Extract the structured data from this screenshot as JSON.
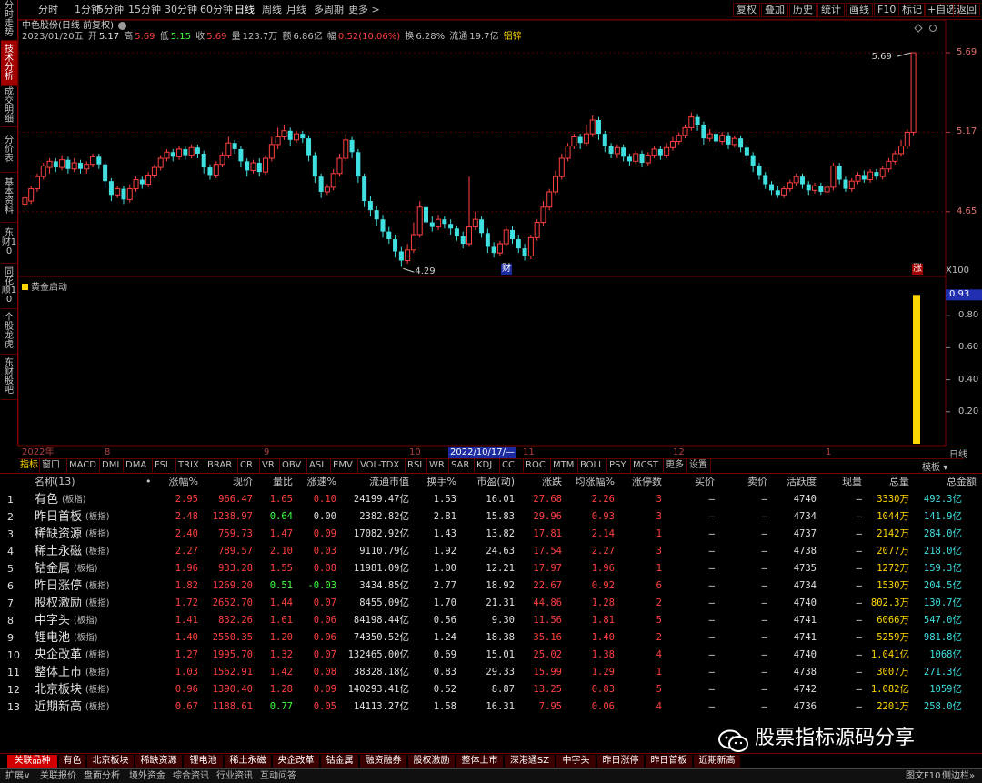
{
  "left_tabs": [
    {
      "label": "分时走势",
      "active": false
    },
    {
      "label": "技术分析",
      "active": true
    },
    {
      "label": "成交明细",
      "active": false
    },
    {
      "label": "分价表",
      "active": false
    },
    {
      "label": "基本资料",
      "active": false
    },
    {
      "label": "东财10",
      "active": false
    },
    {
      "label": "同花顺10",
      "active": false
    },
    {
      "label": "个股龙虎",
      "active": false
    },
    {
      "label": "东财股吧",
      "active": false
    }
  ],
  "periods": [
    "分时",
    "1分钟",
    "5分钟",
    "15分钟",
    "30分钟",
    "60分钟",
    "日线",
    "周线",
    "月线",
    "多周期",
    "更多 >"
  ],
  "active_period": "日线",
  "right_buttons": [
    "复权",
    "叠加",
    "历史",
    "统计",
    "画线",
    "F10",
    "标记",
    "+自选",
    "返回"
  ],
  "kinfo": {
    "title": "中色股份(日线 前复权)",
    "date": "2023/01/20五",
    "open_lbl": "开",
    "open": "5.17",
    "high_lbl": "高",
    "high": "5.69",
    "low_lbl": "低",
    "low": "5.15",
    "close_lbl": "收",
    "close": "5.69",
    "vol_lbl": "量",
    "vol": "123.7万",
    "amt_lbl": "额",
    "amt": "6.86亿",
    "chg_lbl": "幅",
    "chg": "0.52(10.06%)",
    "turn_lbl": "换",
    "turn": "6.28%",
    "float_lbl": "流通",
    "float": "19.7亿",
    "tag": "铝锌"
  },
  "price_axis": [
    "5.69",
    "5.17",
    "4.65"
  ],
  "price_max_label": "5.69",
  "price_min_label": "4.29",
  "fin_marker": "财",
  "zhang_marker": "涨",
  "scale_label": "X100",
  "indicator": {
    "name": "黄金启动",
    "current": "0.93",
    "axis": [
      "0.80",
      "0.60",
      "0.40",
      "0.20"
    ],
    "value": 0.93
  },
  "date_labels": [
    "2022年",
    "8",
    "9",
    "10",
    "2022/10/17/—",
    "11",
    "12",
    "1"
  ],
  "day_label": "日线",
  "ind_tabs": [
    "指标",
    "窗口",
    "MACD",
    "DMI",
    "DMA",
    "FSL",
    "TRIX",
    "BRAR",
    "CR",
    "VR",
    "OBV",
    "ASI",
    "EMV",
    "VOL-TDX",
    "RSI",
    "WR",
    "SAR",
    "KDJ",
    "CCI",
    "ROC",
    "MTM",
    "BOLL",
    "PSY",
    "MCST",
    "更多",
    "设置"
  ],
  "template_btn": "模板",
  "table": {
    "headers": [
      "名称(13)",
      "•",
      "涨幅%",
      "现价",
      "量比",
      "涨速%",
      "流通市值",
      "换手%",
      "市盈(动)",
      "涨跌",
      "均涨幅%",
      "涨停数",
      "买价",
      "卖价",
      "活跃度",
      "现量",
      "总量",
      "总金额"
    ],
    "rows": [
      {
        "no": "1",
        "name": "有色",
        "tag": "(板指)",
        "chg": "2.95",
        "price": "966.47",
        "vr": "1.65",
        "spd": "0.10",
        "mcap": "24199.47亿",
        "turn": "1.53",
        "pe": "16.01",
        "updn": "27.68",
        "avg": "2.26",
        "lim": "3",
        "buy": "—",
        "sell": "—",
        "act": "4740",
        "cur": "—",
        "vol": "3330万",
        "amt": "492.3亿"
      },
      {
        "no": "2",
        "name": "昨日首板",
        "tag": "(板指)",
        "chg": "2.48",
        "price": "1238.97",
        "vr": "0.64",
        "spd": "0.00",
        "mcap": "2382.82亿",
        "turn": "2.81",
        "pe": "15.83",
        "updn": "29.96",
        "avg": "0.93",
        "lim": "3",
        "buy": "—",
        "sell": "—",
        "act": "4734",
        "cur": "—",
        "vol": "1044万",
        "amt": "141.9亿"
      },
      {
        "no": "3",
        "name": "稀缺资源",
        "tag": "(板指)",
        "chg": "2.40",
        "price": "759.73",
        "vr": "1.47",
        "spd": "0.09",
        "mcap": "17082.92亿",
        "turn": "1.43",
        "pe": "13.82",
        "updn": "17.81",
        "avg": "2.14",
        "lim": "1",
        "buy": "—",
        "sell": "—",
        "act": "4737",
        "cur": "—",
        "vol": "2142万",
        "amt": "284.0亿"
      },
      {
        "no": "4",
        "name": "稀土永磁",
        "tag": "(板指)",
        "chg": "2.27",
        "price": "789.57",
        "vr": "2.10",
        "spd": "0.03",
        "mcap": "9110.79亿",
        "turn": "1.92",
        "pe": "24.63",
        "updn": "17.54",
        "avg": "2.27",
        "lim": "3",
        "buy": "—",
        "sell": "—",
        "act": "4738",
        "cur": "—",
        "vol": "2077万",
        "amt": "218.0亿"
      },
      {
        "no": "5",
        "name": "钴金属",
        "tag": "(板指)",
        "chg": "1.96",
        "price": "933.28",
        "vr": "1.55",
        "spd": "0.08",
        "mcap": "11981.09亿",
        "turn": "1.00",
        "pe": "12.21",
        "updn": "17.97",
        "avg": "1.96",
        "lim": "1",
        "buy": "—",
        "sell": "—",
        "act": "4735",
        "cur": "—",
        "vol": "1272万",
        "amt": "159.3亿"
      },
      {
        "no": "6",
        "name": "昨日涨停",
        "tag": "(板指)",
        "chg": "1.82",
        "price": "1269.20",
        "vr": "0.51",
        "spd": "-0.03",
        "mcap": "3434.85亿",
        "turn": "2.77",
        "pe": "18.92",
        "updn": "22.67",
        "avg": "0.92",
        "lim": "6",
        "buy": "—",
        "sell": "—",
        "act": "4734",
        "cur": "—",
        "vol": "1530万",
        "amt": "204.5亿"
      },
      {
        "no": "7",
        "name": "股权激励",
        "tag": "(板指)",
        "chg": "1.72",
        "price": "2652.70",
        "vr": "1.44",
        "spd": "0.07",
        "mcap": "8455.09亿",
        "turn": "1.70",
        "pe": "21.31",
        "updn": "44.86",
        "avg": "1.28",
        "lim": "2",
        "buy": "—",
        "sell": "—",
        "act": "4740",
        "cur": "—",
        "vol": "802.3万",
        "amt": "130.7亿"
      },
      {
        "no": "8",
        "name": "中字头",
        "tag": "(板指)",
        "chg": "1.41",
        "price": "832.26",
        "vr": "1.61",
        "spd": "0.06",
        "mcap": "84198.44亿",
        "turn": "0.56",
        "pe": "9.30",
        "updn": "11.56",
        "avg": "1.81",
        "lim": "5",
        "buy": "—",
        "sell": "—",
        "act": "4741",
        "cur": "—",
        "vol": "6066万",
        "amt": "547.0亿"
      },
      {
        "no": "9",
        "name": "锂电池",
        "tag": "(板指)",
        "chg": "1.40",
        "price": "2550.35",
        "vr": "1.20",
        "spd": "0.06",
        "mcap": "74350.52亿",
        "turn": "1.24",
        "pe": "18.38",
        "updn": "35.16",
        "avg": "1.40",
        "lim": "2",
        "buy": "—",
        "sell": "—",
        "act": "4741",
        "cur": "—",
        "vol": "5259万",
        "amt": "981.8亿"
      },
      {
        "no": "10",
        "name": "央企改革",
        "tag": "(板指)",
        "chg": "1.27",
        "price": "1995.70",
        "vr": "1.32",
        "spd": "0.07",
        "mcap": "132465.00亿",
        "turn": "0.69",
        "pe": "15.01",
        "updn": "25.02",
        "avg": "1.38",
        "lim": "4",
        "buy": "—",
        "sell": "—",
        "act": "4740",
        "cur": "—",
        "vol": "1.041亿",
        "amt": "1068亿"
      },
      {
        "no": "11",
        "name": "整体上市",
        "tag": "(板指)",
        "chg": "1.03",
        "price": "1562.91",
        "vr": "1.42",
        "spd": "0.08",
        "mcap": "38328.18亿",
        "turn": "0.83",
        "pe": "29.33",
        "updn": "15.99",
        "avg": "1.29",
        "lim": "1",
        "buy": "—",
        "sell": "—",
        "act": "4738",
        "cur": "—",
        "vol": "3007万",
        "amt": "271.3亿"
      },
      {
        "no": "12",
        "name": "北京板块",
        "tag": "(板指)",
        "chg": "0.96",
        "price": "1390.40",
        "vr": "1.28",
        "spd": "0.09",
        "mcap": "140293.41亿",
        "turn": "0.52",
        "pe": "8.87",
        "updn": "13.25",
        "avg": "0.83",
        "lim": "5",
        "buy": "—",
        "sell": "—",
        "act": "4742",
        "cur": "—",
        "vol": "1.082亿",
        "amt": "1059亿"
      },
      {
        "no": "13",
        "name": "近期新高",
        "tag": "(板指)",
        "chg": "0.67",
        "price": "1188.61",
        "vr": "0.77",
        "spd": "0.05",
        "mcap": "14113.27亿",
        "turn": "1.58",
        "pe": "16.31",
        "updn": "7.95",
        "avg": "0.06",
        "lim": "4",
        "buy": "—",
        "sell": "—",
        "act": "4736",
        "cur": "—",
        "vol": "2201万",
        "amt": "258.0亿"
      }
    ]
  },
  "block_tabs": [
    "关联品种",
    "有色",
    "北京板块",
    "稀缺资源",
    "锂电池",
    "稀土永磁",
    "央企改革",
    "钴金属",
    "融资融券",
    "股权激励",
    "整体上市",
    "深港通SZ",
    "中字头",
    "昨日涨停",
    "昨日首板",
    "近期新高"
  ],
  "bottom_tabs": [
    "扩展∨",
    "关联报价",
    "盘面分析",
    "境外资金",
    "综合资讯",
    "行业资讯",
    "互动问答"
  ],
  "bottom_right": "图文F10",
  "bottom_right2": "侧边栏»",
  "watermark": "股票指标源码分享",
  "colors": {
    "up": "#ff4040",
    "down": "#40e0e0",
    "yellow": "#ffd700",
    "green": "#40ff40",
    "bg": "#000000",
    "frame": "#7a0000"
  },
  "chart_data": {
    "type": "candlestick",
    "title": "中色股份(日线 前复权)",
    "y_labels": [
      "5.69",
      "5.17",
      "4.65"
    ],
    "ylim": [
      4.25,
      5.75
    ],
    "candles": [
      [
        4.7,
        4.74,
        4.68,
        4.76
      ],
      [
        4.72,
        4.8,
        4.7,
        4.82
      ],
      [
        4.8,
        4.88,
        4.78,
        4.9
      ],
      [
        4.88,
        4.95,
        4.86,
        4.97
      ],
      [
        4.94,
        4.98,
        4.9,
        5.0
      ],
      [
        4.98,
        4.94,
        4.91,
        5.0
      ],
      [
        4.94,
        4.99,
        4.92,
        5.02
      ],
      [
        4.99,
        4.93,
        4.9,
        5.01
      ],
      [
        4.93,
        4.97,
        4.91,
        5.0
      ],
      [
        4.97,
        4.93,
        4.9,
        4.99
      ],
      [
        4.93,
        4.96,
        4.9,
        4.98
      ],
      [
        4.96,
        5.01,
        4.94,
        5.03
      ],
      [
        5.01,
        4.96,
        4.93,
        5.03
      ],
      [
        4.96,
        4.85,
        4.8,
        4.98
      ],
      [
        4.85,
        4.76,
        4.72,
        4.87
      ],
      [
        4.76,
        4.8,
        4.74,
        4.82
      ],
      [
        4.8,
        4.73,
        4.7,
        4.82
      ],
      [
        4.73,
        4.8,
        4.71,
        4.83
      ],
      [
        4.8,
        4.86,
        4.78,
        4.88
      ],
      [
        4.86,
        4.83,
        4.8,
        4.88
      ],
      [
        4.83,
        4.89,
        4.81,
        4.91
      ],
      [
        4.89,
        4.94,
        4.87,
        4.96
      ],
      [
        4.94,
        5.0,
        4.92,
        5.02
      ],
      [
        5.0,
        5.04,
        4.98,
        5.06
      ],
      [
        5.04,
        5.01,
        4.98,
        5.06
      ],
      [
        5.01,
        5.06,
        4.99,
        5.08
      ],
      [
        5.06,
        5.02,
        4.99,
        5.08
      ],
      [
        5.02,
        5.07,
        5.0,
        5.09
      ],
      [
        5.07,
        5.03,
        5.0,
        5.09
      ],
      [
        5.03,
        4.94,
        4.9,
        5.05
      ],
      [
        4.94,
        4.89,
        4.86,
        4.96
      ],
      [
        4.89,
        4.96,
        4.87,
        4.98
      ],
      [
        4.96,
        5.02,
        4.94,
        5.04
      ],
      [
        5.02,
        5.1,
        5.0,
        5.14
      ],
      [
        5.1,
        5.06,
        5.03,
        5.12
      ],
      [
        5.06,
        4.98,
        4.94,
        5.08
      ],
      [
        4.98,
        4.92,
        4.88,
        5.0
      ],
      [
        4.92,
        4.97,
        4.9,
        4.99
      ],
      [
        4.97,
        4.91,
        4.88,
        5.0
      ],
      [
        4.91,
        5.0,
        4.89,
        5.02
      ],
      [
        5.0,
        5.09,
        4.98,
        5.14
      ],
      [
        5.09,
        5.14,
        5.06,
        5.2
      ],
      [
        5.14,
        5.18,
        5.12,
        5.22
      ],
      [
        5.18,
        5.12,
        5.08,
        5.2
      ],
      [
        5.12,
        5.16,
        5.1,
        5.18
      ],
      [
        5.16,
        5.13,
        5.1,
        5.18
      ],
      [
        5.13,
        5.02,
        4.98,
        5.15
      ],
      [
        5.02,
        4.88,
        4.84,
        5.04
      ],
      [
        4.88,
        4.78,
        4.74,
        4.9
      ],
      [
        4.78,
        4.81,
        4.76,
        4.83
      ],
      [
        4.81,
        4.9,
        4.79,
        4.93
      ],
      [
        4.9,
        5.0,
        4.88,
        5.03
      ],
      [
        5.0,
        5.12,
        4.98,
        5.16
      ],
      [
        5.12,
        5.04,
        5.0,
        5.14
      ],
      [
        5.04,
        4.88,
        4.84,
        5.06
      ],
      [
        4.88,
        4.72,
        4.68,
        4.9
      ],
      [
        4.72,
        4.66,
        4.62,
        4.75
      ],
      [
        4.66,
        4.6,
        4.56,
        4.69
      ],
      [
        4.6,
        4.52,
        4.48,
        4.63
      ],
      [
        4.52,
        4.47,
        4.44,
        4.55
      ],
      [
        4.47,
        4.39,
        4.35,
        4.5
      ],
      [
        4.39,
        4.33,
        4.29,
        4.42
      ],
      [
        4.33,
        4.4,
        4.31,
        4.44
      ],
      [
        4.4,
        4.5,
        4.38,
        4.58
      ],
      [
        4.5,
        4.68,
        4.48,
        4.72
      ],
      [
        4.68,
        4.58,
        4.54,
        4.7
      ],
      [
        4.58,
        4.55,
        4.52,
        4.62
      ],
      [
        4.55,
        4.6,
        4.53,
        4.63
      ],
      [
        4.6,
        4.57,
        4.54,
        4.62
      ],
      [
        4.57,
        4.54,
        4.5,
        4.6
      ],
      [
        4.54,
        4.49,
        4.46,
        4.56
      ],
      [
        4.49,
        4.44,
        4.41,
        4.52
      ],
      [
        4.44,
        4.55,
        4.42,
        4.88
      ],
      [
        4.55,
        4.6,
        4.53,
        4.65
      ],
      [
        4.6,
        4.51,
        4.48,
        4.62
      ],
      [
        4.51,
        4.42,
        4.38,
        4.54
      ],
      [
        4.42,
        4.38,
        4.35,
        4.45
      ],
      [
        4.38,
        4.44,
        4.36,
        4.46
      ],
      [
        4.44,
        4.53,
        4.42,
        4.56
      ],
      [
        4.53,
        4.47,
        4.44,
        4.56
      ],
      [
        4.47,
        4.41,
        4.38,
        4.5
      ],
      [
        4.41,
        4.36,
        4.33,
        4.44
      ],
      [
        4.36,
        4.48,
        4.34,
        4.5
      ],
      [
        4.48,
        4.58,
        4.46,
        4.6
      ],
      [
        4.58,
        4.68,
        4.56,
        4.72
      ],
      [
        4.68,
        4.78,
        4.66,
        4.8
      ],
      [
        4.78,
        4.88,
        4.76,
        4.92
      ],
      [
        4.88,
        5.0,
        4.86,
        5.03
      ],
      [
        5.0,
        5.08,
        4.98,
        5.1
      ],
      [
        5.08,
        5.14,
        5.06,
        5.16
      ],
      [
        5.14,
        5.1,
        5.06,
        5.16
      ],
      [
        5.1,
        5.16,
        5.08,
        5.22
      ],
      [
        5.16,
        5.25,
        5.14,
        5.28
      ],
      [
        5.25,
        5.16,
        5.12,
        5.27
      ],
      [
        5.16,
        5.08,
        5.04,
        5.18
      ],
      [
        5.08,
        5.03,
        5.0,
        5.1
      ],
      [
        5.03,
        5.07,
        5.0,
        5.09
      ],
      [
        5.07,
        5.01,
        4.98,
        5.09
      ],
      [
        5.01,
        4.98,
        4.95,
        5.03
      ],
      [
        4.98,
        5.03,
        4.96,
        5.05
      ],
      [
        5.03,
        4.97,
        4.94,
        5.05
      ],
      [
        4.97,
        5.02,
        4.95,
        5.04
      ],
      [
        5.02,
        5.06,
        5.0,
        5.08
      ],
      [
        5.06,
        5.02,
        4.99,
        5.08
      ],
      [
        5.02,
        5.07,
        5.0,
        5.1
      ],
      [
        5.07,
        5.11,
        5.05,
        5.14
      ],
      [
        5.11,
        5.15,
        5.09,
        5.17
      ],
      [
        5.15,
        5.2,
        5.13,
        5.22
      ],
      [
        5.2,
        5.27,
        5.18,
        5.3
      ],
      [
        5.27,
        5.22,
        5.18,
        5.29
      ],
      [
        5.22,
        5.13,
        5.09,
        5.24
      ],
      [
        5.13,
        5.16,
        5.11,
        5.19
      ],
      [
        5.16,
        5.11,
        5.08,
        5.18
      ],
      [
        5.11,
        5.15,
        5.09,
        5.17
      ],
      [
        5.15,
        5.09,
        5.06,
        5.17
      ],
      [
        5.09,
        5.13,
        5.07,
        5.15
      ],
      [
        5.13,
        5.07,
        5.04,
        5.15
      ],
      [
        5.07,
        5.02,
        4.98,
        5.09
      ],
      [
        5.02,
        4.95,
        4.91,
        5.04
      ],
      [
        4.95,
        4.89,
        4.86,
        4.97
      ],
      [
        4.89,
        4.83,
        4.8,
        4.91
      ],
      [
        4.83,
        4.79,
        4.76,
        4.85
      ],
      [
        4.79,
        4.76,
        4.74,
        4.82
      ],
      [
        4.76,
        4.8,
        4.74,
        4.82
      ],
      [
        4.8,
        4.84,
        4.78,
        4.86
      ],
      [
        4.84,
        4.88,
        4.82,
        4.9
      ],
      [
        4.88,
        4.83,
        4.8,
        4.9
      ],
      [
        4.83,
        4.79,
        4.76,
        4.85
      ],
      [
        4.79,
        4.82,
        4.77,
        4.84
      ],
      [
        4.82,
        4.78,
        4.76,
        4.84
      ],
      [
        4.78,
        4.81,
        4.76,
        4.83
      ],
      [
        4.81,
        4.95,
        4.79,
        4.97
      ],
      [
        4.95,
        4.86,
        4.83,
        4.97
      ],
      [
        4.86,
        4.8,
        4.78,
        4.88
      ],
      [
        4.8,
        4.85,
        4.78,
        4.87
      ],
      [
        4.85,
        4.89,
        4.83,
        4.91
      ],
      [
        4.89,
        4.86,
        4.84,
        4.92
      ],
      [
        4.86,
        4.91,
        4.84,
        4.93
      ],
      [
        4.91,
        4.88,
        4.86,
        4.93
      ],
      [
        4.88,
        4.93,
        4.86,
        4.95
      ],
      [
        4.93,
        4.98,
        4.91,
        5.0
      ],
      [
        4.98,
        5.03,
        4.96,
        5.05
      ],
      [
        5.03,
        5.08,
        5.01,
        5.12
      ],
      [
        5.08,
        5.17,
        5.06,
        5.19
      ],
      [
        5.17,
        5.69,
        5.15,
        5.69
      ]
    ],
    "indicator": {
      "name": "黄金启动",
      "last": 0.93,
      "y_labels": [
        "0.80",
        "0.60",
        "0.40",
        "0.20"
      ]
    }
  }
}
